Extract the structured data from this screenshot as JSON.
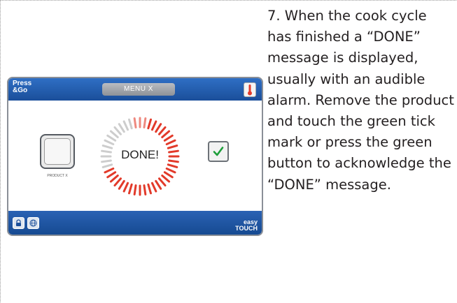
{
  "device": {
    "brand_line1": "Press",
    "brand_line2": "&Go",
    "menu_label": "MENU X",
    "product_label": "PRODUCT X",
    "status_text": "DONE!",
    "logo_line1": "easy",
    "logo_line2": "TOUCH",
    "colors": {
      "topbar": "#1f5aa8",
      "dial_red": "#e23a2a",
      "tick_green": "#1e9e3a"
    },
    "icons": [
      "thermometer-icon",
      "tick-icon",
      "lock-icon",
      "globe-icon"
    ]
  },
  "instruction": {
    "text": "7. When the cook cycle has finished a “DONE” message is displayed, usually with an audible alarm. Remove the product and touch the green tick mark or press the green button to acknowledge the “DONE” message."
  }
}
